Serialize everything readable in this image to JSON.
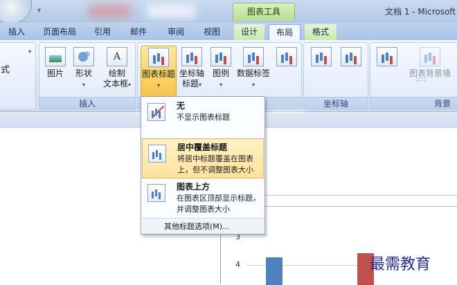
{
  "window": {
    "context_tab": "图表工具",
    "title": "文档 1 - Microsoft"
  },
  "tabs": [
    {
      "label": "插入"
    },
    {
      "label": "页面布局"
    },
    {
      "label": "引用"
    },
    {
      "label": "邮件"
    },
    {
      "label": "审阅"
    },
    {
      "label": "视图"
    },
    {
      "label": "设计"
    },
    {
      "label": "布局"
    },
    {
      "label": "格式"
    }
  ],
  "ribbon": {
    "left_partial": "式",
    "insert_group": {
      "label": "插入",
      "picture": "图片",
      "shapes": "形状",
      "textbox_line1": "绘制",
      "textbox_line2": "文本框"
    },
    "labels_group": {
      "chart_title": "图表标题",
      "axis_title_line1": "坐标轴",
      "axis_title_line2": "标题",
      "legend": "图例",
      "data_labels": "数据标签"
    },
    "axes_group": {
      "label": "坐标轴"
    },
    "background_group": {
      "label": "背景",
      "plot_area": "图表背景墙"
    }
  },
  "dropdown": {
    "items": [
      {
        "title": "无",
        "desc": "不显示图表标题"
      },
      {
        "title": "居中覆盖标题",
        "desc": "将居中标题覆盖在图表上，但不调整图表大小"
      },
      {
        "title": "图表上方",
        "desc": "在图表区顶部显示标题，并调整图表大小"
      }
    ],
    "more": "其他标题选项(M)..."
  },
  "chart_data": {
    "type": "bar",
    "y_ticks": [
      "3",
      "4"
    ],
    "colors": [
      "#4f81bd",
      "#c0504d"
    ]
  },
  "watermark": "最需教育"
}
